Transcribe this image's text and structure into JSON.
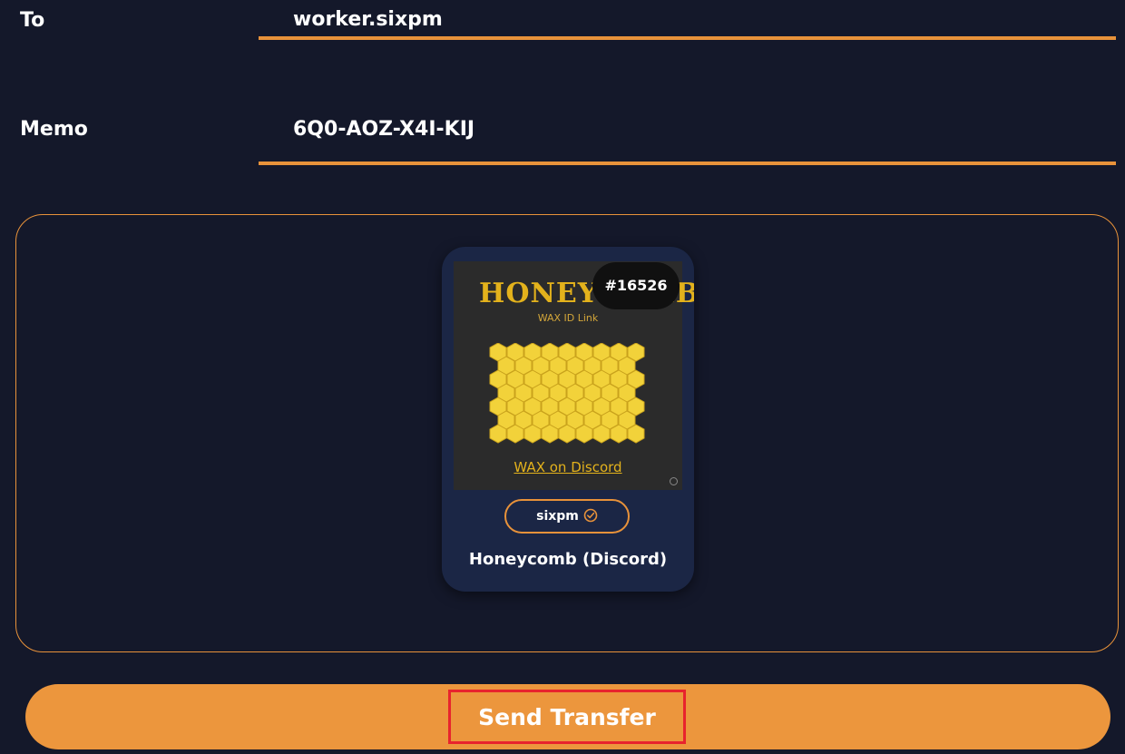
{
  "form": {
    "to_label": "To",
    "to_value": "worker.sixpm",
    "memo_label": "Memo",
    "memo_value": "6Q0-AOZ-X4I-KIJ"
  },
  "nft": {
    "image_title": "HONEYCOMB",
    "image_subtitle": "WAX ID Link",
    "image_link": "WAX on Discord",
    "mint_number": "#16526",
    "collection": "sixpm",
    "collection_verified_icon": "check-circle-icon",
    "name": "Honeycomb (Discord)"
  },
  "actions": {
    "send_label": "Send Transfer"
  },
  "colors": {
    "background": "#14182a",
    "accent": "#e8923a",
    "button": "#ec963d",
    "card": "#1b2645",
    "highlight_box": "#e8232d",
    "honey": "#f2d23a"
  }
}
